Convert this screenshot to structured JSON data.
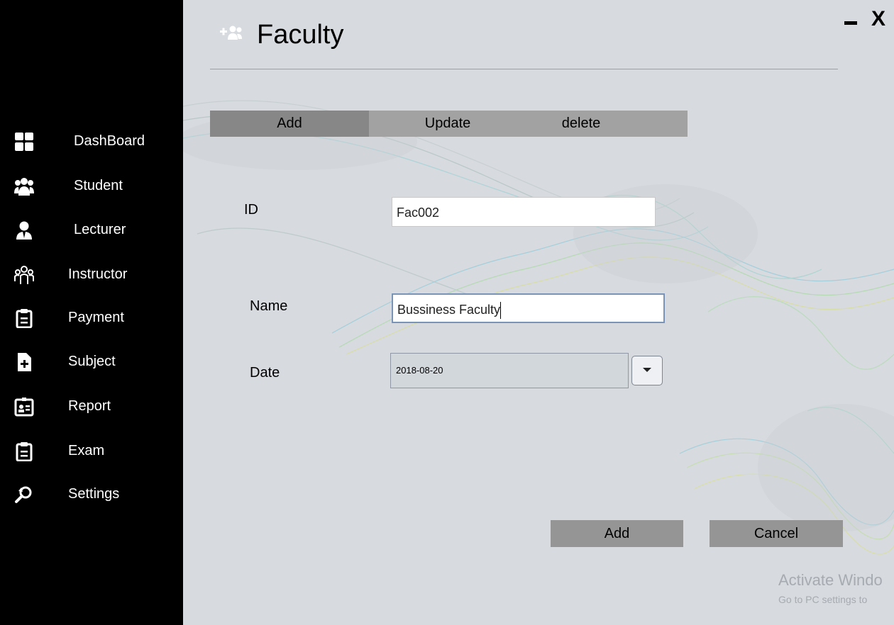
{
  "window": {
    "close_label": "X"
  },
  "page": {
    "title": "Faculty",
    "title_icon": "add-group-icon"
  },
  "sidebar": {
    "items": [
      {
        "label": "DashBoard",
        "icon": "dashboard-grid-icon"
      },
      {
        "label": "Student",
        "icon": "students-group-icon"
      },
      {
        "label": "Lecturer",
        "icon": "lecturer-icon"
      },
      {
        "label": "Instructor",
        "icon": "instructor-group-icon"
      },
      {
        "label": "Payment",
        "icon": "clipboard-icon"
      },
      {
        "label": "Subject",
        "icon": "file-plus-icon"
      },
      {
        "label": "Report",
        "icon": "id-card-icon"
      },
      {
        "label": "Exam",
        "icon": "clipboard-icon"
      },
      {
        "label": "Settings",
        "icon": "search-refresh-icon"
      }
    ]
  },
  "tabs": {
    "add": "Add",
    "update": "Update",
    "delete": "delete"
  },
  "form": {
    "id": {
      "label": "ID",
      "value": "Fac002"
    },
    "name": {
      "label": "Name",
      "value": "Bussiness Faculty"
    },
    "date": {
      "label": "Date",
      "value": "2018-08-20"
    }
  },
  "buttons": {
    "add": "Add",
    "cancel": "Cancel"
  },
  "watermark": {
    "line1": "Activate Windo",
    "line2": "Go to PC settings to"
  },
  "colors": {
    "sidebar_bg": "#000000",
    "content_bg": "#d7dadf",
    "tab_bar": "#a2a2a2",
    "tab_active": "#878787",
    "action_button": "#959595"
  }
}
